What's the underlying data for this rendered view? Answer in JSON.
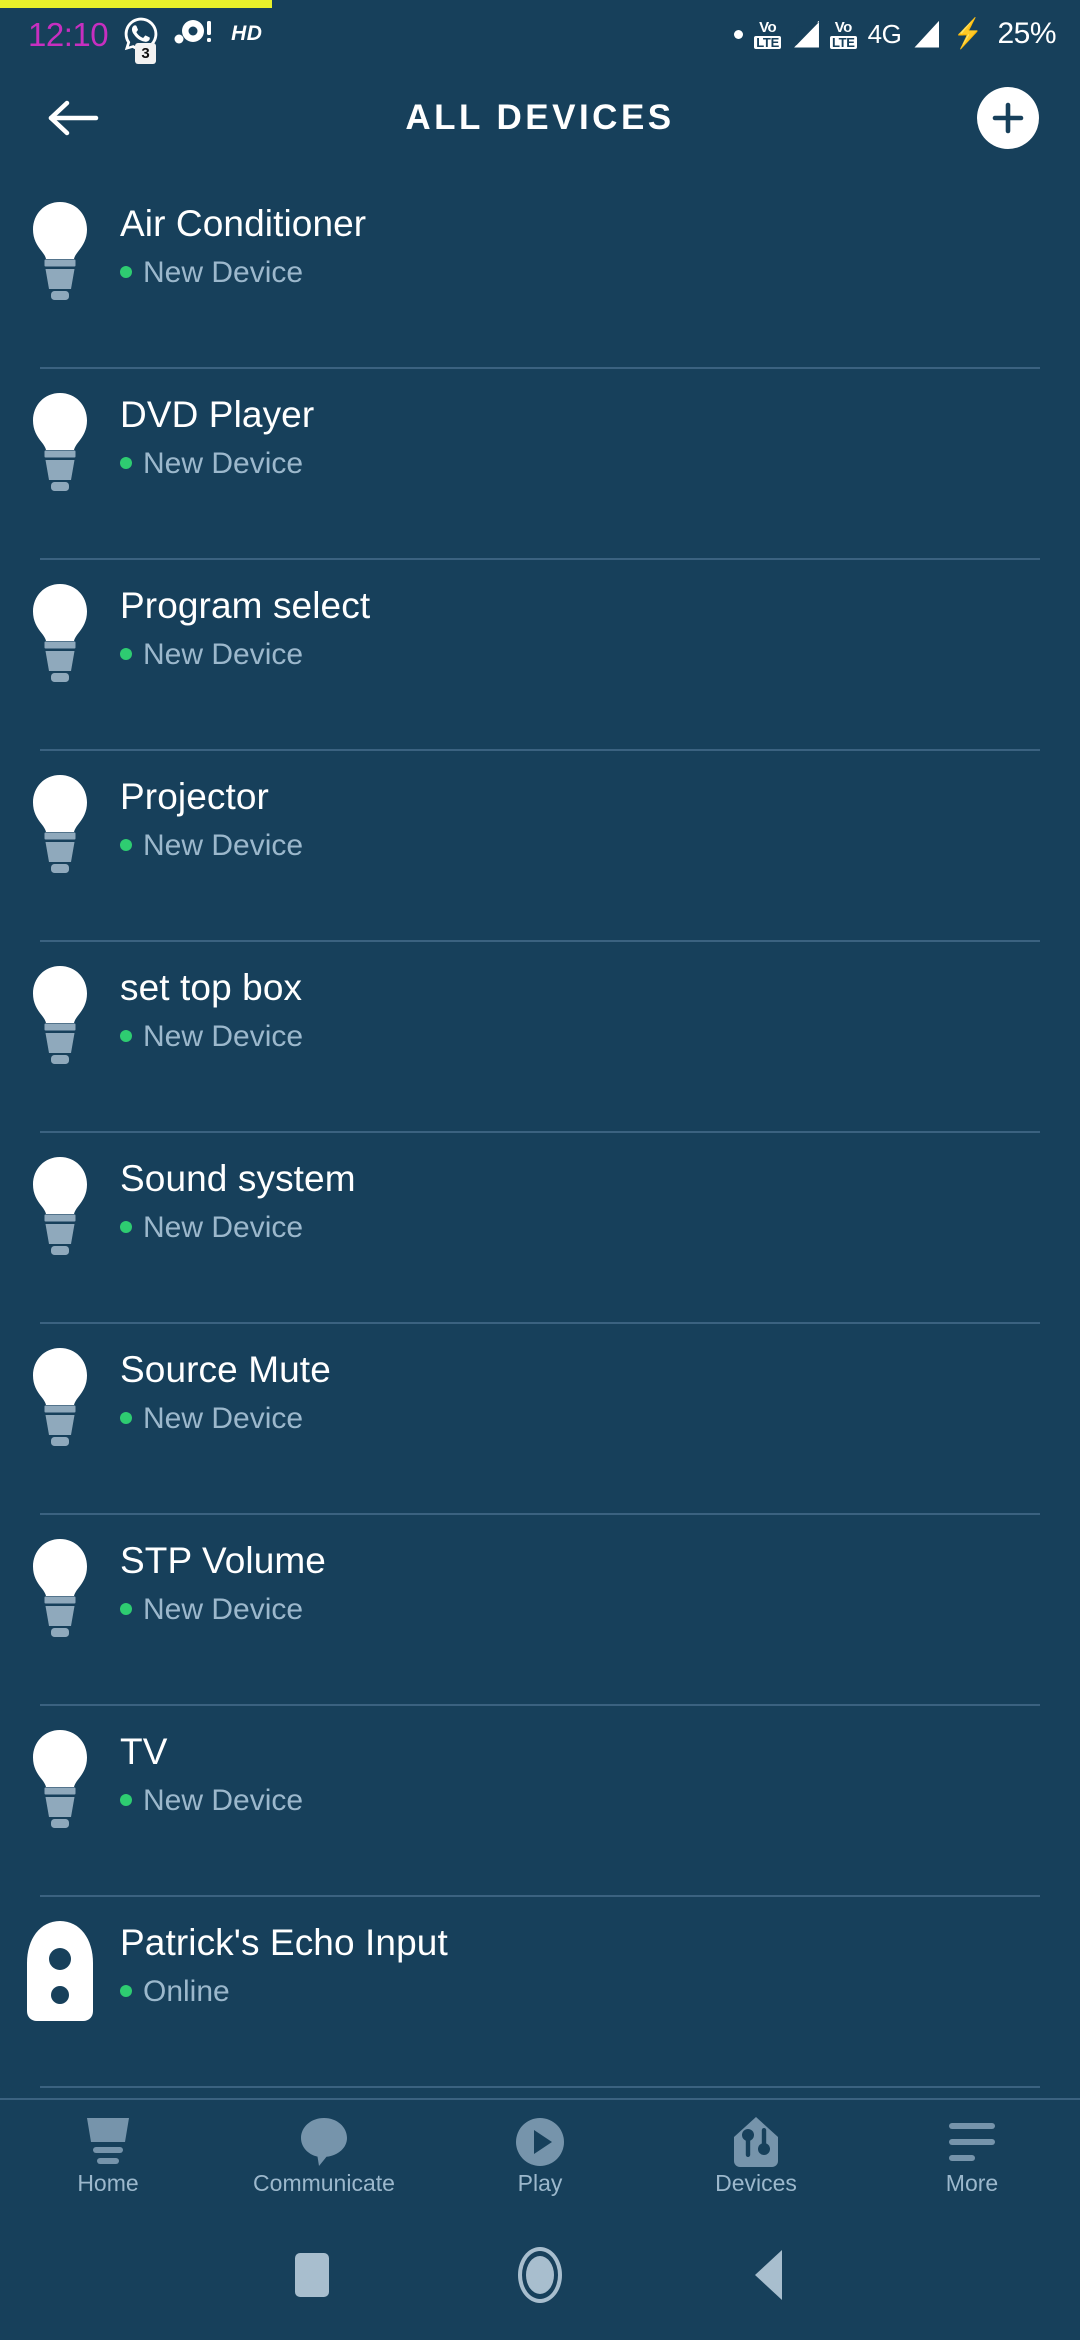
{
  "colors": {
    "background": "#17405B",
    "divider": "#3B6280",
    "accent_white": "#FFFFFF",
    "status_green": "#2ECC71",
    "muted_text": "#9CB8CC",
    "clock_magenta": "#C72FC0",
    "nav_icon": "#7694AB",
    "yellow_strip": "#E8F02A"
  },
  "status_bar": {
    "time": "12:10",
    "whatsapp_icon": "whatsapp-icon",
    "whatsapp_badge": "3",
    "camera_icon": "camera-icon",
    "hd_label": "HD",
    "dot_icon": "white-dot-icon",
    "volte_1": {
      "top": "Vo",
      "bottom": "LTE"
    },
    "signal_1": "signal-partial-icon",
    "volte_2": {
      "top": "Vo",
      "bottom": "LTE"
    },
    "network_label": "4G",
    "signal_2": "signal-full-icon",
    "charging_icon": "charging-bolt-icon",
    "battery_percent": "25%"
  },
  "header": {
    "back_icon": "back-arrow-icon",
    "title": "ALL DEVICES",
    "add_icon": "plus-icon"
  },
  "devices": [
    {
      "name": "Air Conditioner",
      "status": "New Device",
      "icon": "lightbulb-icon"
    },
    {
      "name": "DVD Player",
      "status": "New Device",
      "icon": "lightbulb-icon"
    },
    {
      "name": "Program select",
      "status": "New Device",
      "icon": "lightbulb-icon"
    },
    {
      "name": "Projector",
      "status": "New Device",
      "icon": "lightbulb-icon"
    },
    {
      "name": "set top box",
      "status": "New Device",
      "icon": "lightbulb-icon"
    },
    {
      "name": "Sound system",
      "status": "New Device",
      "icon": "lightbulb-icon"
    },
    {
      "name": "Source Mute",
      "status": "New Device",
      "icon": "lightbulb-icon"
    },
    {
      "name": "STP Volume",
      "status": "New Device",
      "icon": "lightbulb-icon"
    },
    {
      "name": "TV",
      "status": "New Device",
      "icon": "lightbulb-icon"
    },
    {
      "name": "Patrick's Echo Input",
      "status": "Online",
      "icon": "echo-device-icon"
    }
  ],
  "bottom_nav": {
    "items": [
      {
        "label": "Home",
        "icon": "home-icon"
      },
      {
        "label": "Communicate",
        "icon": "speech-bubble-icon"
      },
      {
        "label": "Play",
        "icon": "play-circle-icon"
      },
      {
        "label": "Devices",
        "icon": "devices-house-icon"
      },
      {
        "label": "More",
        "icon": "more-lines-icon"
      }
    ]
  },
  "system_nav": {
    "recents": "recents-square-icon",
    "home": "home-circle-icon",
    "back": "back-triangle-icon"
  }
}
